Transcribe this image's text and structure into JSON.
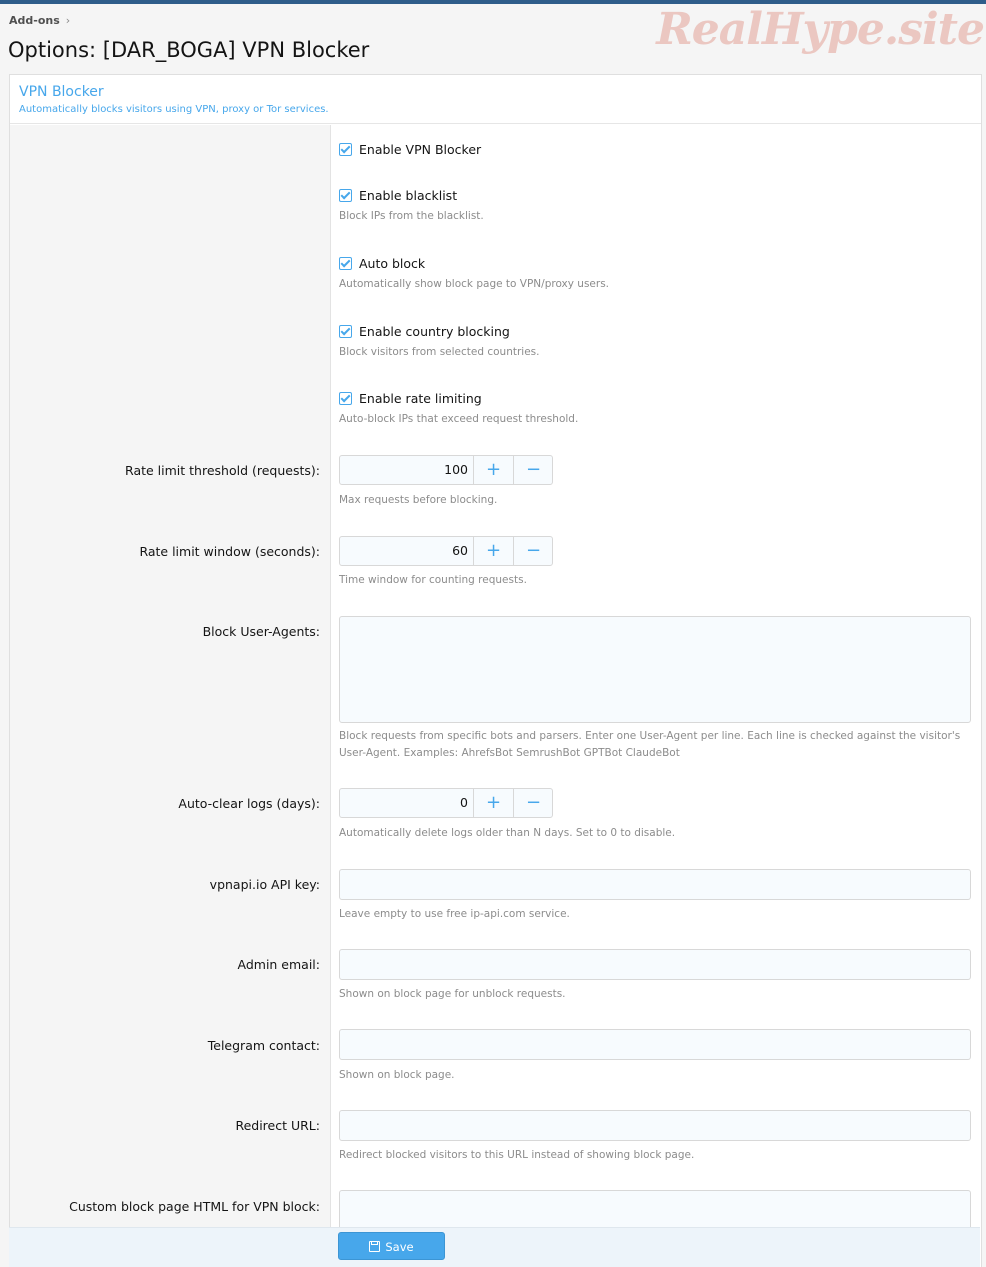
{
  "breadcrumb": {
    "item": "Add-ons"
  },
  "page": {
    "title": "Options: [DAR_BOGA] VPN Blocker",
    "watermark": "RealHype.site"
  },
  "block": {
    "title": "VPN Blocker",
    "description": "Automatically blocks visitors using VPN, proxy or Tor services."
  },
  "checkboxes": [
    {
      "label": "Enable VPN Blocker",
      "checked": true,
      "hint": ""
    },
    {
      "label": "Enable blacklist",
      "checked": true,
      "hint": "Block IPs from the blacklist."
    },
    {
      "label": "Auto block",
      "checked": true,
      "hint": "Automatically show block page to VPN/proxy users."
    },
    {
      "label": "Enable country blocking",
      "checked": true,
      "hint": "Block visitors from selected countries."
    },
    {
      "label": "Enable rate limiting",
      "checked": true,
      "hint": "Auto-block IPs that exceed request threshold."
    }
  ],
  "rate_threshold": {
    "label": "Rate limit threshold (requests):",
    "value": "100",
    "hint": "Max requests before blocking."
  },
  "rate_window": {
    "label": "Rate limit window (seconds):",
    "value": "60",
    "hint": "Time window for counting requests."
  },
  "user_agents": {
    "label": "Block User-Agents:",
    "value": "",
    "hint_line1": "Block requests from specific bots and parsers. Enter one User-Agent per line. Each line is checked against the visitor's",
    "hint_line2": "User-Agent. Examples: AhrefsBot SemrushBot GPTBot ClaudeBot"
  },
  "auto_clear": {
    "label": "Auto-clear logs (days):",
    "value": "0",
    "hint": "Automatically delete logs older than N days. Set to 0 to disable."
  },
  "api_key": {
    "label": "vpnapi.io API key:",
    "value": "",
    "hint": "Leave empty to use free ip-api.com service."
  },
  "admin_email": {
    "label": "Admin email:",
    "value": "",
    "hint": "Shown on block page for unblock requests."
  },
  "telegram": {
    "label": "Telegram contact:",
    "value": "",
    "hint": "Shown on block page."
  },
  "redirect_url": {
    "label": "Redirect URL:",
    "value": "",
    "hint": "Redirect blocked visitors to this URL instead of showing block page."
  },
  "custom_html": {
    "label": "Custom block page HTML for VPN block:",
    "value": ""
  },
  "spin": {
    "plus": "+",
    "minus": "−"
  },
  "footer": {
    "save_label": "Save"
  },
  "colors": {
    "accent": "#47a7eb",
    "topbar": "#2f5d8a"
  }
}
